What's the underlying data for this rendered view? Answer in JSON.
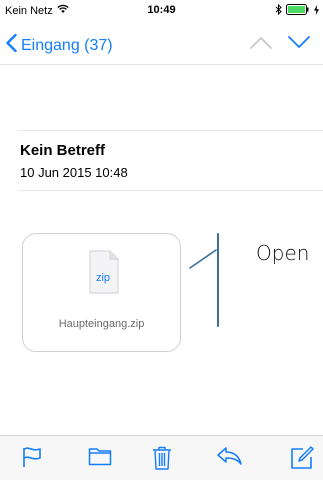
{
  "status_bar": {
    "carrier": "Kein Netz",
    "time": "10:49",
    "icons": [
      "wifi-icon",
      "bluetooth-icon",
      "battery-icon",
      "charging-icon"
    ]
  },
  "nav": {
    "back_label": "Eingang (37)",
    "back_icon": "chevron-left-icon",
    "prev_icon": "chevron-up-icon",
    "next_icon": "chevron-down-icon"
  },
  "message": {
    "subject": "Kein Betreff",
    "date": "10 Jun 2015 10:48"
  },
  "attachment": {
    "type_label": "zip",
    "file_name": "Haupteingang.zip",
    "icon": "zip-file-icon"
  },
  "annotation": {
    "text": "Open"
  },
  "toolbar": {
    "items": [
      "flag-icon",
      "folder-icon",
      "trash-icon",
      "reply-icon",
      "compose-icon"
    ]
  },
  "colors": {
    "accent": "#157efb",
    "disabled": "#c7c7cc",
    "battery": "#4cd964"
  }
}
